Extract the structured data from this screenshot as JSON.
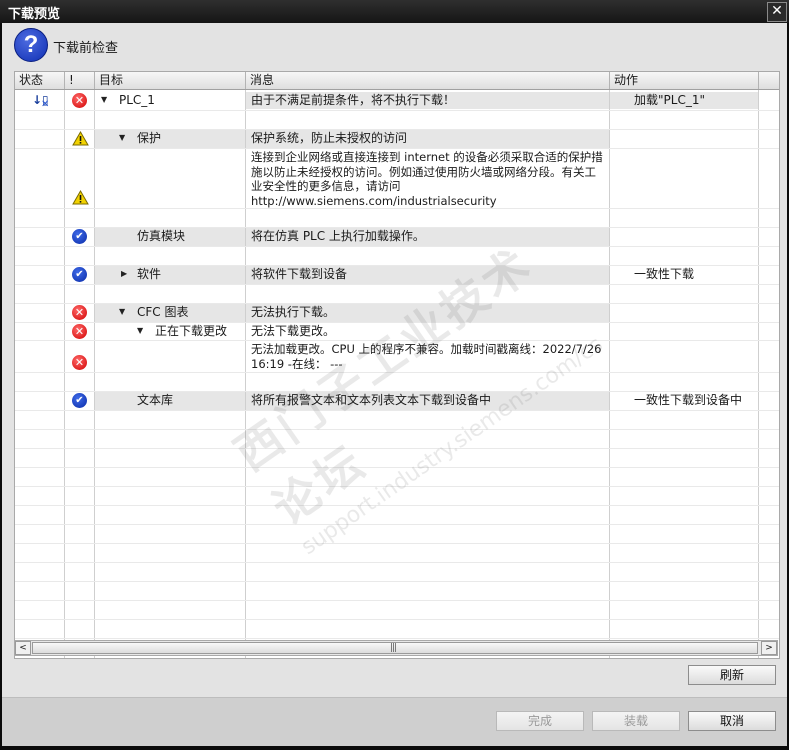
{
  "window": {
    "title": "下载预览",
    "close_glyph": "✕"
  },
  "header": {
    "title": "下载前检查"
  },
  "columns": {
    "status": "状态",
    "flag": "!",
    "target": "目标",
    "message": "消息",
    "action": "动作"
  },
  "rows": [
    {
      "status_icon": "download-to-device-icon",
      "flag": "error",
      "expander": "expanded",
      "target": "PLC_1",
      "message": "由于不满足前提条件，将不执行下载！",
      "action": "加载\"PLC_1\""
    },
    {
      "status_icon": "",
      "flag": "warning",
      "expander": "expanded",
      "target": "保护",
      "message": "保护系统，防止未授权的访问",
      "action": ""
    },
    {
      "status_icon": "",
      "flag": "warning",
      "expander": "",
      "target": "",
      "message": "连接到企业网络或直接连接到 internet 的设备必须采取合适的保护措施以防止未经授权的访问。例如通过使用防火墙或网络分段。有关工业安全性的更多信息，请访问\nhttp://www.siemens.com/industrialsecurity",
      "action": ""
    },
    {
      "status_icon": "",
      "flag": "ok",
      "expander": "",
      "target": "仿真模块",
      "message": "将在仿真 PLC 上执行加载操作。",
      "action": ""
    },
    {
      "status_icon": "",
      "flag": "ok",
      "expander": "collapsed",
      "target": "软件",
      "message": "将软件下载到设备",
      "action": "一致性下载"
    },
    {
      "status_icon": "",
      "flag": "error",
      "expander": "expanded",
      "target": "CFC 图表",
      "message": "无法执行下载。",
      "action": ""
    },
    {
      "status_icon": "",
      "flag": "error",
      "expander": "expanded",
      "target": "正在下载更改",
      "message": "无法下载更改。",
      "action": ""
    },
    {
      "status_icon": "",
      "flag": "error",
      "expander": "",
      "target": "",
      "message": "无法加载更改。CPU 上的程序不兼容。加载时间戳离线：2022/7/26 16:19 -在线： ---",
      "action": ""
    },
    {
      "status_icon": "",
      "flag": "ok",
      "expander": "",
      "target": "文本库",
      "message": "将所有报警文本和文本列表文本下载到设备中",
      "action": "一致性下载到设备中"
    }
  ],
  "watermark": {
    "line1": "西门子工业技术论坛",
    "line2": "support.industry.siemens.com/cs"
  },
  "scrollbar": {
    "left_arrow": "<",
    "right_arrow": ">",
    "grip": "|||"
  },
  "buttons": {
    "refresh": "刷新",
    "finish": "完成",
    "load": "装载",
    "cancel": "取消"
  },
  "colors": {
    "error": "#d10000",
    "ok": "#0a2ba8",
    "warning": "#f2d200"
  }
}
